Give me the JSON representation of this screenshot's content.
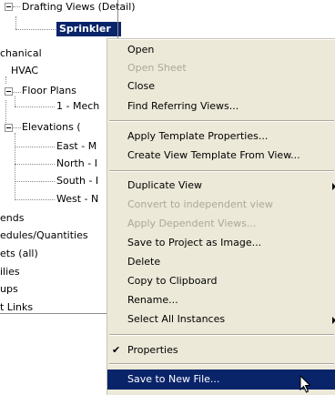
{
  "tree": {
    "items": [
      {
        "label": "Drafting Views (Detail)"
      },
      {
        "label": "Sprinkler Head Drop Detail"
      },
      {
        "label": "chanical"
      },
      {
        "label": "HVAC"
      },
      {
        "label": "Floor Plans"
      },
      {
        "label": "1 - Mech"
      },
      {
        "label": "Elevations ("
      },
      {
        "label": "East - M"
      },
      {
        "label": "North - I"
      },
      {
        "label": "South - I"
      },
      {
        "label": "West - N"
      },
      {
        "label": "ends"
      },
      {
        "label": "edules/Quantities"
      },
      {
        "label": "ets (all)"
      },
      {
        "label": "ilies"
      },
      {
        "label": "ups"
      },
      {
        "label": "t Links"
      }
    ]
  },
  "menu": {
    "items": [
      {
        "label": "Open",
        "enabled": true
      },
      {
        "label": "Open Sheet",
        "enabled": false
      },
      {
        "label": "Close",
        "enabled": true
      },
      {
        "label": "Find Referring Views...",
        "enabled": true
      },
      {
        "label": "Apply Template Properties...",
        "enabled": true
      },
      {
        "label": "Create View Template From View...",
        "enabled": true
      },
      {
        "label": "Duplicate View",
        "enabled": true,
        "submenu": true
      },
      {
        "label": "Convert to independent view",
        "enabled": false
      },
      {
        "label": "Apply Dependent Views...",
        "enabled": false
      },
      {
        "label": "Save to Project as Image...",
        "enabled": true
      },
      {
        "label": "Delete",
        "enabled": true
      },
      {
        "label": "Copy to Clipboard",
        "enabled": true
      },
      {
        "label": "Rename...",
        "enabled": true
      },
      {
        "label": "Select All Instances",
        "enabled": true,
        "submenu": true
      },
      {
        "label": "Properties",
        "enabled": true,
        "checked": true
      },
      {
        "label": "Save to New File...",
        "enabled": true,
        "highlighted": true
      }
    ]
  },
  "colors": {
    "menu_bg": "#ece9d8",
    "highlight": "#0a246a",
    "disabled_text": "#aca899"
  }
}
